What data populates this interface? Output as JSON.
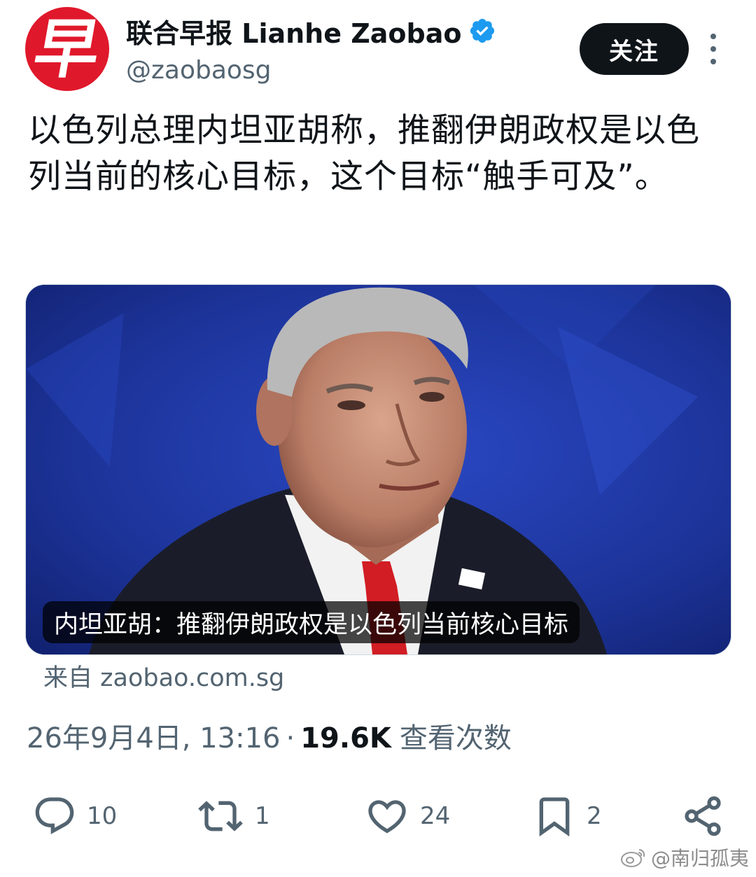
{
  "account": {
    "display_name": "联合早报 Lianhe Zaobao",
    "handle": "@zaobaosg",
    "avatar_glyph": "早",
    "verified": true
  },
  "follow_button": {
    "label": "关注"
  },
  "tweet": {
    "text": "以色列总理内坦亚胡称，推翻伊朗政权是以色列当前的核心目标，这个目标“触手可及”。",
    "media_caption": "内坦亚胡：推翻伊朗政权是以色列当前核心目标",
    "source": "来自 zaobao.com.sg",
    "timestamp": "26年9月4日, 13:16",
    "separator": "·",
    "views_count": "19.6K",
    "views_label": "查看次数"
  },
  "actions": {
    "reply_count": "10",
    "retweet_count": "1",
    "like_count": "24",
    "bookmark_count": "2"
  },
  "watermark": {
    "text": "@南归孤夷"
  },
  "icons": {
    "verified": "verified-badge-icon",
    "more": "more-vertical-icon",
    "reply": "reply-icon",
    "retweet": "retweet-icon",
    "like": "heart-icon",
    "bookmark": "bookmark-icon",
    "share": "share-icon",
    "weibo": "weibo-icon"
  },
  "colors": {
    "brand_red": "#e0182b",
    "verified_blue": "#1d9bf0",
    "text_primary": "#0f1419",
    "text_secondary": "#536471",
    "button_bg": "#0f1419"
  }
}
